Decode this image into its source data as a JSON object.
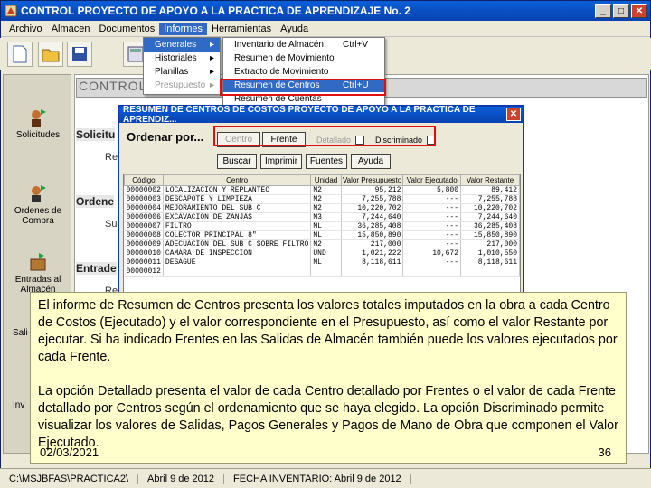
{
  "window": {
    "title": "CONTROL   PROYECTO DE APOYO A LA PRACTICA DE APRENDIZAJE No. 2"
  },
  "menubar": {
    "items": [
      "Archivo",
      "Almacen",
      "Documentos",
      "Informes",
      "Herramientas",
      "Ayuda"
    ],
    "active": "Informes"
  },
  "informes_menu": {
    "items": [
      "Generales",
      "Historiales",
      "Planillas",
      "Presupuesto"
    ]
  },
  "generales_menu": {
    "items": [
      {
        "label": "Inventario de Almacén",
        "shortcut": "Ctrl+V"
      },
      {
        "label": "Resumen de Movimiento",
        "shortcut": ""
      },
      {
        "label": "Extracto de Movimiento",
        "shortcut": ""
      },
      {
        "label": "Resumen de Centros",
        "shortcut": "Ctrl+U"
      },
      {
        "label": "Resumen de Cuentas",
        "shortcut": ""
      }
    ]
  },
  "sidebar": {
    "items": [
      "Solicitudes",
      "Ordenes de Compra",
      "Entradas al Almacén",
      "Sali",
      "Inv"
    ]
  },
  "main": {
    "header": "CONTROL -",
    "sections": [
      "Solicitu",
      "Ordene",
      "Entrade"
    ],
    "subs": [
      "Re",
      "Su",
      "Re"
    ]
  },
  "dialog": {
    "title": "RESUMEN DE CENTROS DE COSTOS   PROYECTO DE APOYO A LA PRACTICA DE APRENDIZ...",
    "order_label": "Ordenar por...",
    "order_options": [
      "Centro",
      "Frente"
    ],
    "detallado": "Detallado",
    "discriminado": "Discriminado",
    "actions": [
      "Buscar",
      "Imprimir",
      "Fuentes",
      "Ayuda"
    ],
    "columns": [
      "Código",
      "Centro",
      "Unidad",
      "Valor Presupuesto",
      "Valor Ejecutado",
      "Valor Restante"
    ],
    "rows": [
      [
        "00000002",
        "LOCALIZACION Y REPLANTEO",
        "M2",
        "95,212",
        "5,800",
        "89,412"
      ],
      [
        "00000003",
        "DESCAPOTE Y LIMPIEZA",
        "M2",
        "7,255,788",
        "---",
        "7,255,788"
      ],
      [
        "00000004",
        "MEJORAMIENTO DEL SUB C",
        "M2",
        "10,220,702",
        "---",
        "10,220,702"
      ],
      [
        "00000006",
        "EXCAVACION DE ZANJAS",
        "M3",
        "7,244,640",
        "---",
        "7,244,640"
      ],
      [
        "00000007",
        "FILTRO",
        "ML",
        "36,285,408",
        "---",
        "36,285,408"
      ],
      [
        "00000008",
        "COLECTOR PRINCIPAL 8\"",
        "ML",
        "15,850,890",
        "---",
        "15,850,890"
      ],
      [
        "00000009",
        "ADECUACION DEL SUB C SOBRE FILTRO",
        "M2",
        "217,000",
        "---",
        "217,000"
      ],
      [
        "00000010",
        "CAMARA DE INSPECCION",
        "UND",
        "1,021,222",
        "10,672",
        "1,010,550"
      ],
      [
        "00000011",
        "DESAGUE",
        "ML",
        "8,118,611",
        "---",
        "8,118,611"
      ],
      [
        "00000012",
        "",
        "",
        "",
        "",
        ""
      ]
    ]
  },
  "info_box": {
    "p1": "El informe de Resumen de Centros presenta los valores totales imputados en la obra a cada Centro de Costos (Ejecutado) y el valor correspondiente en el Presupuesto, así como el valor Restante por ejecutar. Si ha indicado Frentes en las Salidas de Almacén también puede los valores ejecutados por cada Frente.",
    "p2": "La opción Detallado presenta el valor de cada Centro detallado por Frentes o el valor de cada Frente detallado por Centros según el ordenamiento que se haya elegido. La opción Discriminado permite visualizar los valores de Salidas, Pagos Generales y Pagos de Mano de Obra que componen el Valor Ejecutado.",
    "date": "02/03/2021",
    "page": "36"
  },
  "statusbar": {
    "path": "C:\\MSJBFAS\\PRACTICA2\\",
    "date": "Abril 9 de 2012",
    "inventario": "FECHA INVENTARIO: Abril 9 de 2012"
  },
  "colors": {
    "title_blue": "#0842b0",
    "highlight": "#316ac5",
    "annotation_red": "#e01010",
    "note_bg": "#ffffcc"
  }
}
